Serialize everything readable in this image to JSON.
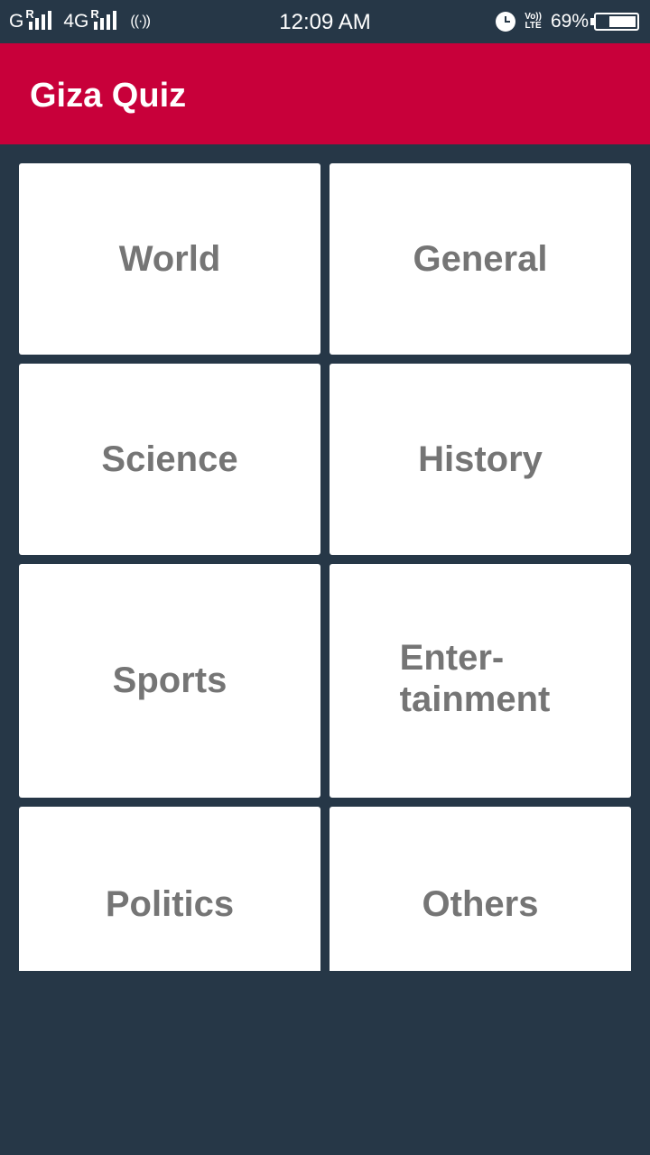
{
  "status_bar": {
    "network_1": "G",
    "network_2": "4G",
    "roaming_1": "R",
    "roaming_2": "R",
    "hotspot": "((·))",
    "time": "12:09 AM",
    "volte_line1": "Vo))",
    "volte_line2": "LTE",
    "battery_percent": "69%",
    "battery_level": 0.69,
    "icons": [
      "signal-icon",
      "hotspot-icon",
      "alarm-icon",
      "volte-icon",
      "battery-icon"
    ]
  },
  "app_bar": {
    "title": "Giza Quiz",
    "color": "#c8003a"
  },
  "categories": [
    {
      "label": "World"
    },
    {
      "label": "General"
    },
    {
      "label": "Science"
    },
    {
      "label": "History"
    },
    {
      "label": "Sports"
    },
    {
      "label_line1": "Enter-",
      "label_line2": "tainment"
    },
    {
      "label": "Politics"
    },
    {
      "label": "Others"
    }
  ],
  "colors": {
    "background": "#263747",
    "card": "#ffffff",
    "card_text": "#757575"
  }
}
